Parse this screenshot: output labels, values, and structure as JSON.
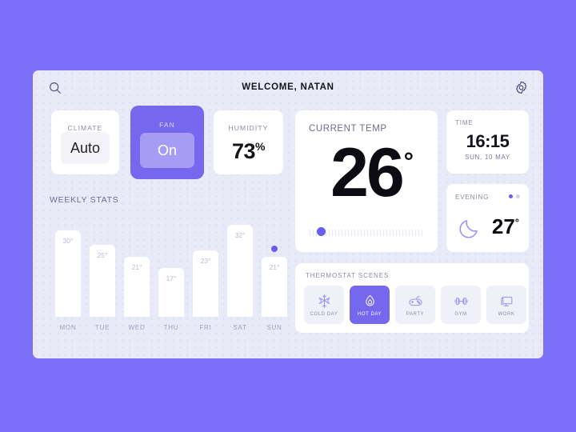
{
  "theme": {
    "page_bg": "#7c6ff9",
    "panel_bg": "#e9eaf7",
    "accent": "#6b5cf0",
    "accent_card": "#7667ef",
    "card_bg": "#ffffff"
  },
  "header": {
    "title": "WELCOME, NATAN",
    "search_icon": "search-icon",
    "settings_icon": "gear-icon"
  },
  "climate": {
    "label": "CLIMATE",
    "value": "Auto"
  },
  "fan": {
    "label": "FAN",
    "value": "On"
  },
  "humidity": {
    "label": "HUMIDITY",
    "value": "73",
    "unit": "%"
  },
  "current_temp": {
    "label": "CURRENT TEMP",
    "value": "26",
    "degree": "°",
    "slider_position_percent": 6
  },
  "time": {
    "label": "TIME",
    "value": "16:15",
    "date": "SUN, 10 MAY"
  },
  "evening": {
    "label": "EVENING",
    "icon": "moon-icon",
    "value": "27",
    "degree": "°",
    "dots": [
      true,
      false
    ]
  },
  "weekly_stats": {
    "title": "WEEKLY STATS"
  },
  "chart_data": {
    "type": "bar",
    "title": "WEEKLY STATS",
    "xlabel": "",
    "ylabel": "",
    "unit": "°",
    "grid": false,
    "legend": false,
    "ylim": [
      0,
      34
    ],
    "categories": [
      "MON",
      "TUE",
      "WED",
      "THU",
      "FRI",
      "SAT",
      "SUN"
    ],
    "values": [
      30,
      25,
      21,
      17,
      23,
      32,
      21
    ],
    "value_labels": [
      "30°",
      "25°",
      "21°",
      "17°",
      "23°",
      "32°",
      "21°"
    ],
    "highlight_index": 6,
    "highlight_marker": "dot"
  },
  "scenes": {
    "title": "THERMOSTAT SCENES",
    "items": [
      {
        "label": "COLD DAY",
        "icon": "snowflake-icon",
        "active": false
      },
      {
        "label": "HOT DAY",
        "icon": "flame-icon",
        "active": true
      },
      {
        "label": "PARTY",
        "icon": "gamepad-icon",
        "active": false
      },
      {
        "label": "GYM",
        "icon": "dumbbell-icon",
        "active": false
      },
      {
        "label": "WORK",
        "icon": "monitor-icon",
        "active": false
      }
    ]
  }
}
